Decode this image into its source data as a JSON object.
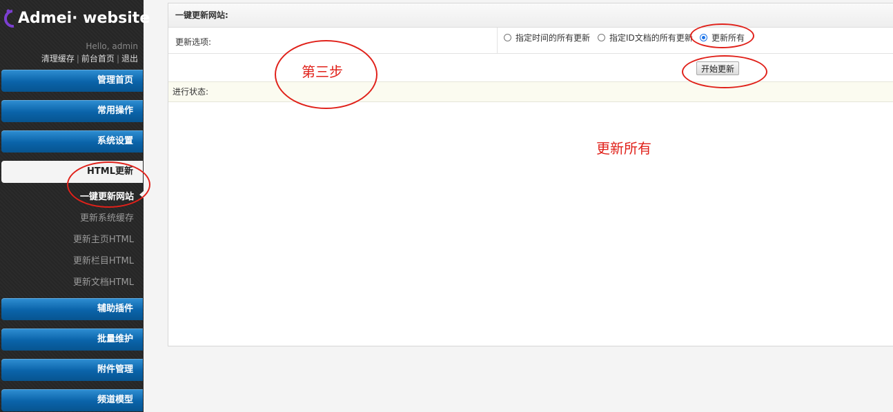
{
  "brand": {
    "name": "Admei· website"
  },
  "user": {
    "greeting": "Hello, admin"
  },
  "quick_links": [
    {
      "label": "清理缓存"
    },
    {
      "label": "前台首页"
    },
    {
      "label": "退出"
    }
  ],
  "sidebar": {
    "menus": [
      {
        "label": "管理首页"
      },
      {
        "label": "常用操作"
      },
      {
        "label": "系统设置"
      },
      {
        "label": "HTML更新"
      },
      {
        "label": "辅助插件"
      },
      {
        "label": "批量维护"
      },
      {
        "label": "附件管理"
      },
      {
        "label": "频道模型"
      }
    ],
    "submenu": [
      {
        "label": "一键更新网站"
      },
      {
        "label": "更新系统缓存"
      },
      {
        "label": "更新主页HTML"
      },
      {
        "label": "更新栏目HTML"
      },
      {
        "label": "更新文档HTML"
      }
    ]
  },
  "panel": {
    "title": "一键更新网站:",
    "options_label": "更新选项:",
    "radio_options": [
      {
        "label": "指定时间的所有更新",
        "checked": false
      },
      {
        "label": "指定ID文档的所有更新",
        "checked": false
      },
      {
        "label": "更新所有",
        "checked": true
      }
    ],
    "start_button": "开始更新",
    "status_label": "进行状态:"
  },
  "annotations": {
    "step": "第三步",
    "note": "更新所有",
    "color": "#e0211a"
  },
  "colors": {
    "menu_blue": "#0a63a9",
    "sidebar_bg": "#262626"
  }
}
